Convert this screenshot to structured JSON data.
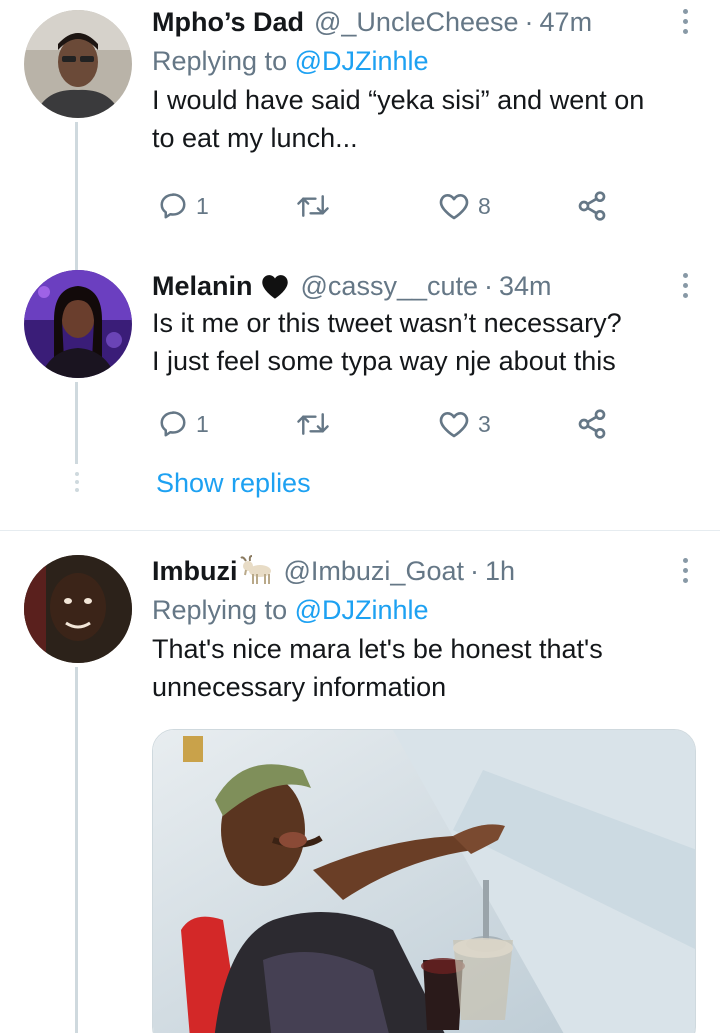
{
  "tweets": [
    {
      "name": "Mpho’s Dad",
      "handle": "@_UncleCheese",
      "sep": "·",
      "time": "47m",
      "replying_prefix": "Replying to ",
      "replying_to": "@DJZinhle",
      "text_lines": [
        "I would have said “yeka sisi” and went on",
        "to eat my lunch..."
      ],
      "replies": "1",
      "retweets": "",
      "likes": "8"
    },
    {
      "name": "Melanin",
      "name_emoji": "black-heart",
      "handle": "@cassy__cute",
      "sep": "·",
      "time": "34m",
      "text_lines": [
        "Is it me or this tweet wasn’t necessary?",
        "I just feel some typa way nje about this"
      ],
      "replies": "1",
      "retweets": "",
      "likes": "3",
      "show_replies": "Show replies"
    },
    {
      "name": "Imbuzi",
      "name_emoji": "goat",
      "handle": "@Imbuzi_Goat",
      "sep": "·",
      "time": "1h",
      "replying_prefix": "Replying to ",
      "replying_to": "@DJZinhle",
      "text_lines": [
        "That's nice mara let's be honest that's",
        "unnecessary information"
      ]
    }
  ],
  "icons": {
    "reply": "speech-bubble-icon",
    "retweet": "retweet-icon",
    "like": "heart-icon",
    "share": "share-icon",
    "more": "more-vertical-icon"
  },
  "colors": {
    "link": "#1da1f2",
    "muted": "#657786",
    "text": "#14171a",
    "thread_line": "#cfd9de"
  }
}
